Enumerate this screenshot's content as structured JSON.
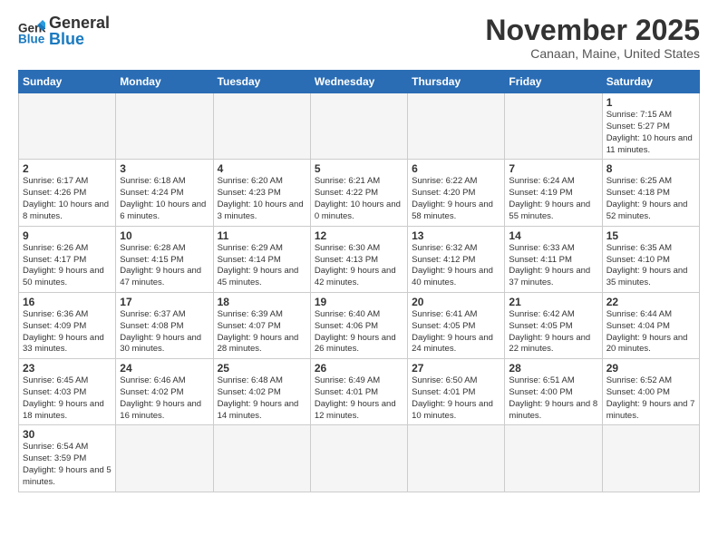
{
  "header": {
    "logo_general": "General",
    "logo_blue": "Blue",
    "month_title": "November 2025",
    "location": "Canaan, Maine, United States"
  },
  "days_of_week": [
    "Sunday",
    "Monday",
    "Tuesday",
    "Wednesday",
    "Thursday",
    "Friday",
    "Saturday"
  ],
  "weeks": [
    [
      {
        "num": "",
        "info": ""
      },
      {
        "num": "",
        "info": ""
      },
      {
        "num": "",
        "info": ""
      },
      {
        "num": "",
        "info": ""
      },
      {
        "num": "",
        "info": ""
      },
      {
        "num": "",
        "info": ""
      },
      {
        "num": "1",
        "info": "Sunrise: 7:15 AM\nSunset: 5:27 PM\nDaylight: 10 hours and 11 minutes."
      }
    ],
    [
      {
        "num": "2",
        "info": "Sunrise: 6:17 AM\nSunset: 4:26 PM\nDaylight: 10 hours and 8 minutes."
      },
      {
        "num": "3",
        "info": "Sunrise: 6:18 AM\nSunset: 4:24 PM\nDaylight: 10 hours and 6 minutes."
      },
      {
        "num": "4",
        "info": "Sunrise: 6:20 AM\nSunset: 4:23 PM\nDaylight: 10 hours and 3 minutes."
      },
      {
        "num": "5",
        "info": "Sunrise: 6:21 AM\nSunset: 4:22 PM\nDaylight: 10 hours and 0 minutes."
      },
      {
        "num": "6",
        "info": "Sunrise: 6:22 AM\nSunset: 4:20 PM\nDaylight: 9 hours and 58 minutes."
      },
      {
        "num": "7",
        "info": "Sunrise: 6:24 AM\nSunset: 4:19 PM\nDaylight: 9 hours and 55 minutes."
      },
      {
        "num": "8",
        "info": "Sunrise: 6:25 AM\nSunset: 4:18 PM\nDaylight: 9 hours and 52 minutes."
      }
    ],
    [
      {
        "num": "9",
        "info": "Sunrise: 6:26 AM\nSunset: 4:17 PM\nDaylight: 9 hours and 50 minutes."
      },
      {
        "num": "10",
        "info": "Sunrise: 6:28 AM\nSunset: 4:15 PM\nDaylight: 9 hours and 47 minutes."
      },
      {
        "num": "11",
        "info": "Sunrise: 6:29 AM\nSunset: 4:14 PM\nDaylight: 9 hours and 45 minutes."
      },
      {
        "num": "12",
        "info": "Sunrise: 6:30 AM\nSunset: 4:13 PM\nDaylight: 9 hours and 42 minutes."
      },
      {
        "num": "13",
        "info": "Sunrise: 6:32 AM\nSunset: 4:12 PM\nDaylight: 9 hours and 40 minutes."
      },
      {
        "num": "14",
        "info": "Sunrise: 6:33 AM\nSunset: 4:11 PM\nDaylight: 9 hours and 37 minutes."
      },
      {
        "num": "15",
        "info": "Sunrise: 6:35 AM\nSunset: 4:10 PM\nDaylight: 9 hours and 35 minutes."
      }
    ],
    [
      {
        "num": "16",
        "info": "Sunrise: 6:36 AM\nSunset: 4:09 PM\nDaylight: 9 hours and 33 minutes."
      },
      {
        "num": "17",
        "info": "Sunrise: 6:37 AM\nSunset: 4:08 PM\nDaylight: 9 hours and 30 minutes."
      },
      {
        "num": "18",
        "info": "Sunrise: 6:39 AM\nSunset: 4:07 PM\nDaylight: 9 hours and 28 minutes."
      },
      {
        "num": "19",
        "info": "Sunrise: 6:40 AM\nSunset: 4:06 PM\nDaylight: 9 hours and 26 minutes."
      },
      {
        "num": "20",
        "info": "Sunrise: 6:41 AM\nSunset: 4:05 PM\nDaylight: 9 hours and 24 minutes."
      },
      {
        "num": "21",
        "info": "Sunrise: 6:42 AM\nSunset: 4:05 PM\nDaylight: 9 hours and 22 minutes."
      },
      {
        "num": "22",
        "info": "Sunrise: 6:44 AM\nSunset: 4:04 PM\nDaylight: 9 hours and 20 minutes."
      }
    ],
    [
      {
        "num": "23",
        "info": "Sunrise: 6:45 AM\nSunset: 4:03 PM\nDaylight: 9 hours and 18 minutes."
      },
      {
        "num": "24",
        "info": "Sunrise: 6:46 AM\nSunset: 4:02 PM\nDaylight: 9 hours and 16 minutes."
      },
      {
        "num": "25",
        "info": "Sunrise: 6:48 AM\nSunset: 4:02 PM\nDaylight: 9 hours and 14 minutes."
      },
      {
        "num": "26",
        "info": "Sunrise: 6:49 AM\nSunset: 4:01 PM\nDaylight: 9 hours and 12 minutes."
      },
      {
        "num": "27",
        "info": "Sunrise: 6:50 AM\nSunset: 4:01 PM\nDaylight: 9 hours and 10 minutes."
      },
      {
        "num": "28",
        "info": "Sunrise: 6:51 AM\nSunset: 4:00 PM\nDaylight: 9 hours and 8 minutes."
      },
      {
        "num": "29",
        "info": "Sunrise: 6:52 AM\nSunset: 4:00 PM\nDaylight: 9 hours and 7 minutes."
      }
    ],
    [
      {
        "num": "30",
        "info": "Sunrise: 6:54 AM\nSunset: 3:59 PM\nDaylight: 9 hours and 5 minutes."
      },
      {
        "num": "",
        "info": ""
      },
      {
        "num": "",
        "info": ""
      },
      {
        "num": "",
        "info": ""
      },
      {
        "num": "",
        "info": ""
      },
      {
        "num": "",
        "info": ""
      },
      {
        "num": "",
        "info": ""
      }
    ]
  ]
}
